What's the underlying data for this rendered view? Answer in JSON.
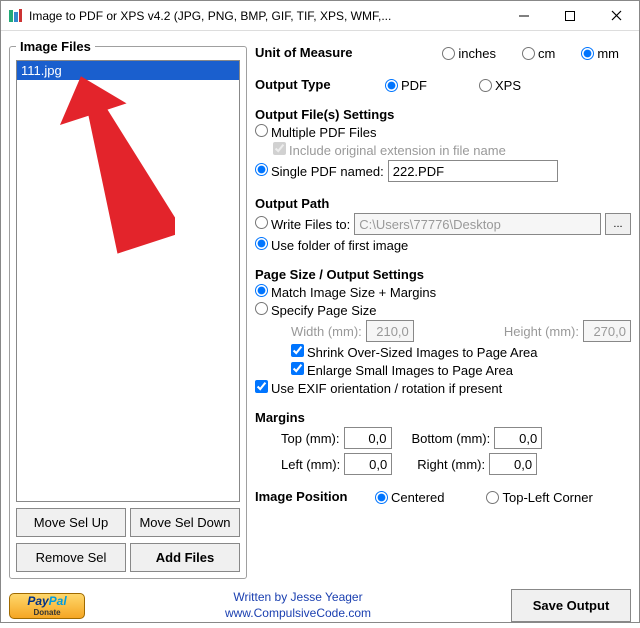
{
  "window": {
    "title": "Image to PDF or XPS  v4.2   (JPG, PNG, BMP, GIF, TIF, XPS, WMF,..."
  },
  "left": {
    "legend": "Image Files",
    "items": [
      "111.jpg"
    ],
    "move_up": "Move Sel Up",
    "move_down": "Move Sel Down",
    "remove": "Remove Sel",
    "add": "Add Files"
  },
  "unit": {
    "legend": "Unit of Measure",
    "inches": "inches",
    "cm": "cm",
    "mm": "mm"
  },
  "output_type": {
    "legend": "Output Type",
    "pdf": "PDF",
    "xps": "XPS"
  },
  "file_settings": {
    "legend": "Output File(s) Settings",
    "multiple": "Multiple PDF Files",
    "include_ext": "Include original extension in file name",
    "single": "Single PDF named:",
    "single_value": "222.PDF"
  },
  "output_path": {
    "legend": "Output Path",
    "write_to": "Write Files to:",
    "path_value": "C:\\Users\\77776\\Desktop",
    "use_folder": "Use folder of first image"
  },
  "page": {
    "legend": "Page Size / Output Settings",
    "match": "Match Image Size + Margins",
    "specify": "Specify Page Size",
    "width_label": "Width (mm):",
    "width_value": "210,0",
    "height_label": "Height (mm):",
    "height_value": "270,0",
    "shrink": "Shrink Over-Sized Images to Page Area",
    "enlarge": "Enlarge Small Images to Page Area",
    "exif": "Use EXIF orientation / rotation if present"
  },
  "margins": {
    "legend": "Margins",
    "top": "Top (mm):",
    "top_v": "0,0",
    "bottom": "Bottom (mm):",
    "bottom_v": "0,0",
    "left": "Left (mm):",
    "left_v": "0,0",
    "right": "Right (mm):",
    "right_v": "0,0"
  },
  "position": {
    "legend": "Image Position",
    "centered": "Centered",
    "topleft": "Top-Left Corner"
  },
  "footer": {
    "written": "Written by Jesse Yeager",
    "site": "www.CompulsiveCode.com",
    "save": "Save Output"
  }
}
